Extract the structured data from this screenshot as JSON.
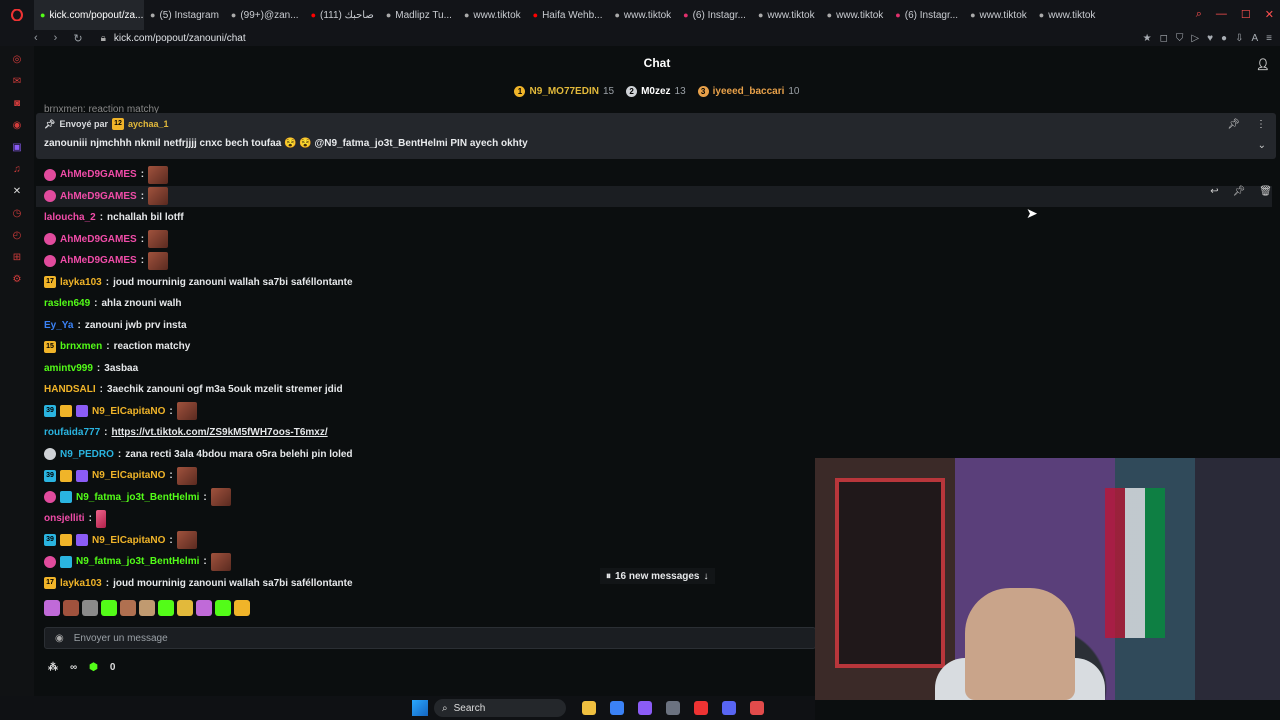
{
  "browser": {
    "tabs": [
      {
        "label": "kick.com/popout/za...",
        "icon": "kick-icon",
        "active": true
      },
      {
        "label": "(5) Instagram",
        "icon": "loading-icon"
      },
      {
        "label": "(99+)@zan...",
        "icon": "tiktok-icon"
      },
      {
        "label": "(111) صاحبك",
        "icon": "youtube-icon"
      },
      {
        "label": "Madlipz Tu...",
        "icon": "madlipz-icon"
      },
      {
        "label": "www.tiktok",
        "icon": "page-icon"
      },
      {
        "label": "Haifa Wehb...",
        "icon": "youtube-icon"
      },
      {
        "label": "www.tiktok",
        "icon": "page-icon"
      },
      {
        "label": "(6) Instagr...",
        "icon": "instagram-icon"
      },
      {
        "label": "www.tiktok",
        "icon": "page-icon"
      },
      {
        "label": "www.tiktok",
        "icon": "page-icon"
      },
      {
        "label": "(6) Instagr...",
        "icon": "instagram-icon"
      },
      {
        "label": "www.tiktok",
        "icon": "page-icon"
      },
      {
        "label": "www.tiktok",
        "icon": "page-icon"
      }
    ],
    "url": "kick.com/popout/zanouni/chat"
  },
  "chat": {
    "title": "Chat",
    "leaders": [
      {
        "rank": "1",
        "name": "N9_MO77EDIN",
        "points": "15",
        "color": "#e2b93b"
      },
      {
        "rank": "2",
        "name": "M0zez",
        "points": "13",
        "color": "#ffffff"
      },
      {
        "rank": "3",
        "name": "iyeeed_baccari",
        "points": "10",
        "color": "#e8a14a"
      }
    ],
    "cutoff_line": "brnxmen: reaction matchy",
    "pinned": {
      "sent_by_label": "Envoyé par",
      "sent_by_badge": "12",
      "sent_by_user": "aychaa_1",
      "message": "zanouniii njmchhh nkmil netfrjjjj cnxc bech toufaa 😵 😵 @N9_fatma_jo3t_BentHelmi PIN ayech okhty"
    },
    "messages": [
      {
        "user": "AhMeD9GAMES",
        "color": "#f04ca8",
        "badges": [
          "pink"
        ],
        "text": "",
        "emote": true
      },
      {
        "user": "AhMeD9GAMES",
        "color": "#f04ca8",
        "badges": [
          "pink"
        ],
        "text": "",
        "emote": true,
        "highlight": true
      },
      {
        "user": "laloucha_2",
        "color": "#f04ca8",
        "badges": [],
        "text": "nchallah bil lotff"
      },
      {
        "user": "AhMeD9GAMES",
        "color": "#f04ca8",
        "badges": [
          "pink"
        ],
        "text": "",
        "emote": true
      },
      {
        "user": "AhMeD9GAMES",
        "color": "#f04ca8",
        "badges": [
          "pink"
        ],
        "text": "",
        "emote": true
      },
      {
        "user": "layka103",
        "color": "#f0b429",
        "badges": [
          "gold"
        ],
        "badge_texts": [
          "17"
        ],
        "text": "joud mourninig zanouni wallah sa7bi saféllontante"
      },
      {
        "user": "raslen649",
        "color": "#53fc18",
        "badges": [],
        "text": "ahla znouni walh"
      },
      {
        "user": "Ey_Ya",
        "color": "#3b82f6",
        "badges": [],
        "text": "zanouni jwb prv insta"
      },
      {
        "user": "brnxmen",
        "color": "#53fc18",
        "badges": [
          "gold"
        ],
        "badge_texts": [
          "15"
        ],
        "text": "reaction matchy"
      },
      {
        "user": "amintv999",
        "color": "#53fc18",
        "badges": [],
        "text": "3asbaa"
      },
      {
        "user": "HANDSALI",
        "color": "#f0b429",
        "badges": [],
        "text": "3aechik zanouni ogf m3a 5ouk mzelit stremer jdid"
      },
      {
        "user": "N9_ElCapitaNO",
        "color": "#f0b429",
        "badges": [
          "cyan",
          "gold",
          "purple"
        ],
        "badge_texts": [
          "39",
          "",
          ""
        ],
        "text": "",
        "emote": true
      },
      {
        "user": "roufaida777",
        "color": "#2ab4e0",
        "badges": [],
        "text": "https://vt.tiktok.com/ZS9kM5fWH7oos-T6mxz/",
        "link": true
      },
      {
        "user": "N9_PEDRO",
        "color": "#2ab4e0",
        "badges": [
          "grey"
        ],
        "text": "zana recti 3ala 4bdou mara o5ra belehi pin loled"
      },
      {
        "user": "N9_ElCapitaNO",
        "color": "#f0b429",
        "badges": [
          "cyan",
          "gold",
          "purple"
        ],
        "badge_texts": [
          "39",
          "",
          ""
        ],
        "text": "",
        "emote": true
      },
      {
        "user": "N9_fatma_jo3t_BentHelmi",
        "color": "#53fc18",
        "badges": [
          "pink",
          "cyan"
        ],
        "text": "",
        "emote": true
      },
      {
        "user": "onsjelliti",
        "color": "#f04ca8",
        "badges": [],
        "text": "",
        "emote_pink": true
      },
      {
        "user": "N9_ElCapitaNO",
        "color": "#f0b429",
        "badges": [
          "cyan",
          "gold",
          "purple"
        ],
        "badge_texts": [
          "39",
          "",
          ""
        ],
        "text": "",
        "emote": true
      },
      {
        "user": "N9_fatma_jo3t_BentHelmi",
        "color": "#53fc18",
        "badges": [
          "pink",
          "cyan"
        ],
        "text": "",
        "emote": true
      },
      {
        "user": "layka103",
        "color": "#f0b429",
        "badges": [
          "gold"
        ],
        "badge_texts": [
          "17"
        ],
        "text": "joud mourninig zanouni wallah sa7bi saféllontante"
      }
    ],
    "new_messages_label": "16 new messages",
    "input_placeholder": "Envoyer un message",
    "footer": {
      "infinity_label": "∞",
      "points": "0"
    }
  },
  "taskbar": {
    "search_label": "Search"
  },
  "colors": {
    "accent": "#53fc18",
    "background": "#0b0e0f"
  }
}
